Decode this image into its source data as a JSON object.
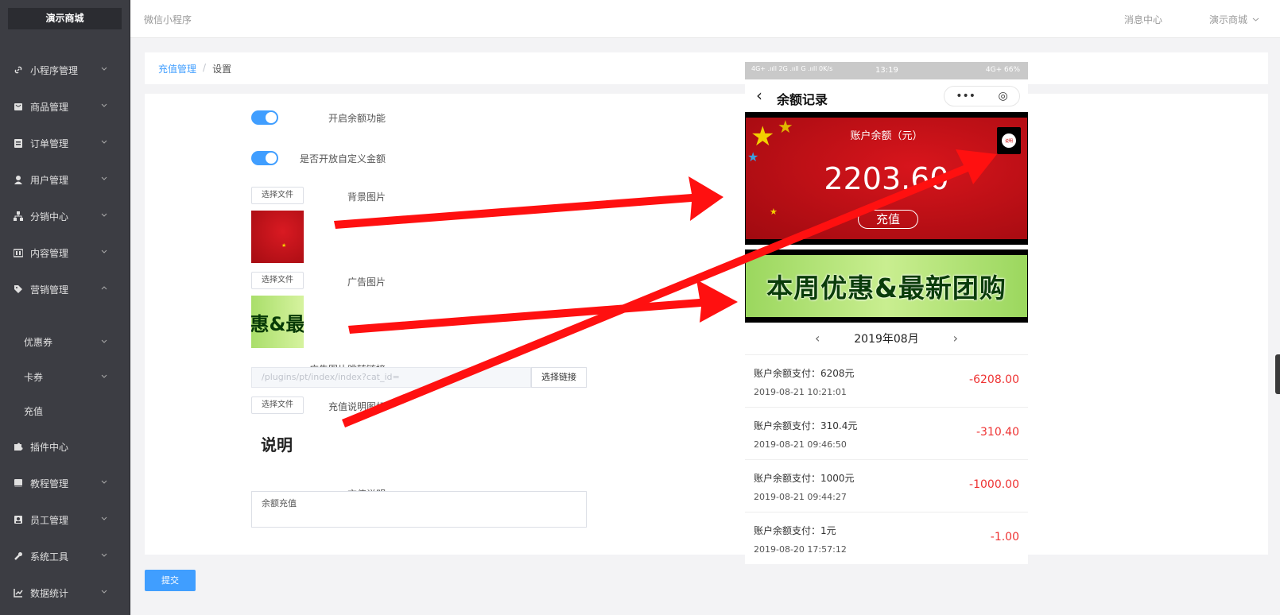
{
  "sidebar": {
    "brand": "演示商城",
    "items": [
      {
        "label": "小程序管理",
        "icon": "link-icon"
      },
      {
        "label": "商品管理",
        "icon": "shopping-bag-icon"
      },
      {
        "label": "订单管理",
        "icon": "clipboard-icon"
      },
      {
        "label": "用户管理",
        "icon": "user-icon"
      },
      {
        "label": "分销中心",
        "icon": "hierarchy-icon"
      },
      {
        "label": "内容管理",
        "icon": "content-icon"
      },
      {
        "label": "营销管理",
        "icon": "tag-icon"
      }
    ],
    "sub_items": [
      "优惠券",
      "卡券",
      "充值"
    ],
    "items_after": [
      {
        "label": "插件中心",
        "icon": "puzzle-icon"
      },
      {
        "label": "教程管理",
        "icon": "book-icon"
      },
      {
        "label": "员工管理",
        "icon": "staff-icon"
      },
      {
        "label": "系统工具",
        "icon": "wrench-icon"
      },
      {
        "label": "数据统计",
        "icon": "chart-icon"
      }
    ]
  },
  "header": {
    "title": "微信小程序",
    "messages": "消息中心",
    "user": "演示商城"
  },
  "breadcrumb": {
    "parent": "充值管理",
    "separator": "/",
    "current": "设置"
  },
  "form": {
    "enable_balance_label": "开启余额功能",
    "enable_balance_on": true,
    "custom_amount_label": "是否开放自定义金额",
    "custom_amount_on": true,
    "bg_image_label": "背景图片",
    "ad_image_label": "广告图片",
    "choose_file": "选择文件",
    "ad_link_label": "广告图片跳转链接",
    "ad_link_placeholder": "/plugins/pt/index/index?cat_id=",
    "choose_link": "选择链接",
    "explain_icon_label": "充值说明图标",
    "explain_icon_text": "说明",
    "explain_label": "充值说明",
    "explain_value": "余额充值",
    "ad_thumb_text": "惠&最",
    "submit": "提交"
  },
  "phone": {
    "status_left": "4G+ .ııll 2G .ııll G .ııll 0K/s",
    "status_time": "13:19",
    "status_right": "4G+ 66%",
    "nav_title": "余额记录",
    "nav_back": "‹",
    "capsule_more": "•••",
    "capsule_close": "◎",
    "balance_caption": "账户余额（元）",
    "balance_amount": "2203.60",
    "recharge_btn": "充值",
    "explain_mini": "说明",
    "ad_text": "本周优惠&最新团购",
    "month": "2019年08月",
    "prev": "‹",
    "next": "›",
    "records": [
      {
        "name": "账户余额支付：6208元",
        "date": "2019-08-21 10:21:01",
        "value": "-6208.00"
      },
      {
        "name": "账户余额支付：310.4元",
        "date": "2019-08-21 09:46:50",
        "value": "-310.40"
      },
      {
        "name": "账户余额支付：1000元",
        "date": "2019-08-21 09:44:27",
        "value": "-1000.00"
      },
      {
        "name": "账户余额支付：1元",
        "date": "2019-08-20 17:57:12",
        "value": "-1.00"
      }
    ]
  },
  "colors": {
    "primary": "#409eff",
    "sidebar": "#3c3d43",
    "arrow": "#ff1010",
    "negative": "#e33333"
  }
}
